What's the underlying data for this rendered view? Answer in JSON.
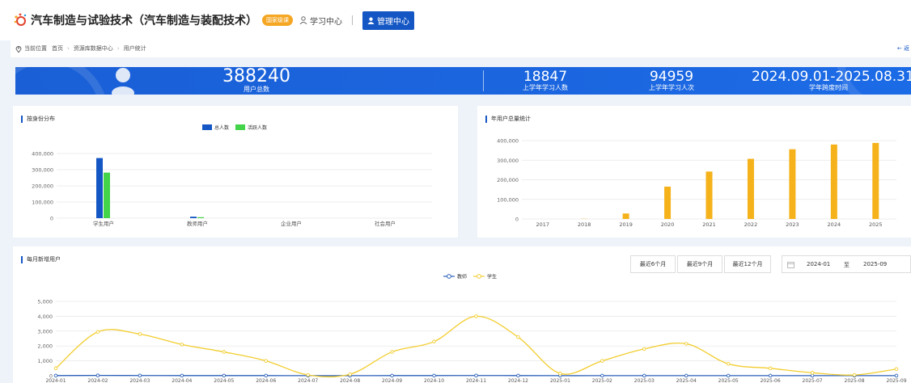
{
  "header": {
    "course_title": "汽车制造与试验技术（汽车制造与装配技术）",
    "badge": "国家级课",
    "learning_center": "学习中心",
    "management_center": "管理中心"
  },
  "breadcrumb": {
    "prefix": "当前位置",
    "items": [
      "首页",
      "资源库数据中心",
      "用户统计"
    ],
    "back": "← 返"
  },
  "banner": {
    "total_users_value": "388240",
    "total_users_label": "用户总数",
    "learners_value": "18847",
    "learners_label": "上学年学习人数",
    "visits_value": "94959",
    "visits_label": "上学年学习人次",
    "span_value": "2024.09.01-2025.08.31",
    "span_label": "学年跨度时间"
  },
  "colors": {
    "primary": "#1456c4",
    "green": "#44d44a",
    "orange": "#f5b21a",
    "teacher_line": "#2a5fb8",
    "student_line": "#f2cd2e"
  },
  "identity_chart": {
    "title": "按身份分布",
    "chart_data": {
      "type": "bar",
      "categories": [
        "学生用户",
        "教师用户",
        "企业用户",
        "社会用户"
      ],
      "series": [
        {
          "name": "总人数",
          "values": [
            372000,
            9000,
            0,
            0
          ]
        },
        {
          "name": "活跃人数",
          "values": [
            282000,
            6000,
            0,
            0
          ]
        }
      ],
      "yticks": [
        "400,000",
        "300,000",
        "200,000",
        "100,000",
        "0"
      ],
      "ylim": [
        0,
        400000
      ],
      "legend": "top-center",
      "grid": true
    }
  },
  "yearly_chart": {
    "title": "年用户总量统计",
    "chart_data": {
      "type": "bar",
      "categories": [
        "2017",
        "2018",
        "2019",
        "2020",
        "2021",
        "2022",
        "2023",
        "2024",
        "2025"
      ],
      "values": [
        0,
        1000,
        28000,
        165000,
        242000,
        307000,
        356000,
        380000,
        388000
      ],
      "yticks": [
        "400,000",
        "300,000",
        "200,000",
        "100,000",
        "0"
      ],
      "ylim": [
        0,
        400000
      ],
      "grid": true
    }
  },
  "monthly_chart": {
    "title": "每月新增用户",
    "filters": [
      "最近6个月",
      "最近9个月",
      "最近12个月"
    ],
    "date_from": "2024-01",
    "date_to_label": "至",
    "date_to": "2025-09",
    "chart_data": {
      "type": "line",
      "x": [
        "2024-01",
        "2024-02",
        "2024-03",
        "2024-04",
        "2024-05",
        "2024-06",
        "2024-07",
        "2024-08",
        "2024-09",
        "2024-10",
        "2024-11",
        "2024-12",
        "2025-01",
        "2025-02",
        "2025-03",
        "2025-04",
        "2025-05",
        "2025-06",
        "2025-07",
        "2025-08",
        "2025-09"
      ],
      "series": [
        {
          "name": "教师",
          "values": [
            10,
            20,
            15,
            10,
            10,
            10,
            5,
            5,
            10,
            10,
            15,
            10,
            5,
            5,
            5,
            5,
            5,
            5,
            5,
            5,
            5
          ]
        },
        {
          "name": "学生",
          "values": [
            500,
            2950,
            2800,
            2100,
            1600,
            1000,
            50,
            100,
            1600,
            2300,
            4000,
            2600,
            150,
            1000,
            1800,
            2150,
            800,
            500,
            200,
            50,
            450
          ]
        }
      ],
      "yticks": [
        "5,000",
        "4,000",
        "3,000",
        "2,000",
        "1,000",
        "0"
      ],
      "ylim": [
        0,
        5000
      ],
      "legend": "top-center",
      "grid": true
    }
  }
}
